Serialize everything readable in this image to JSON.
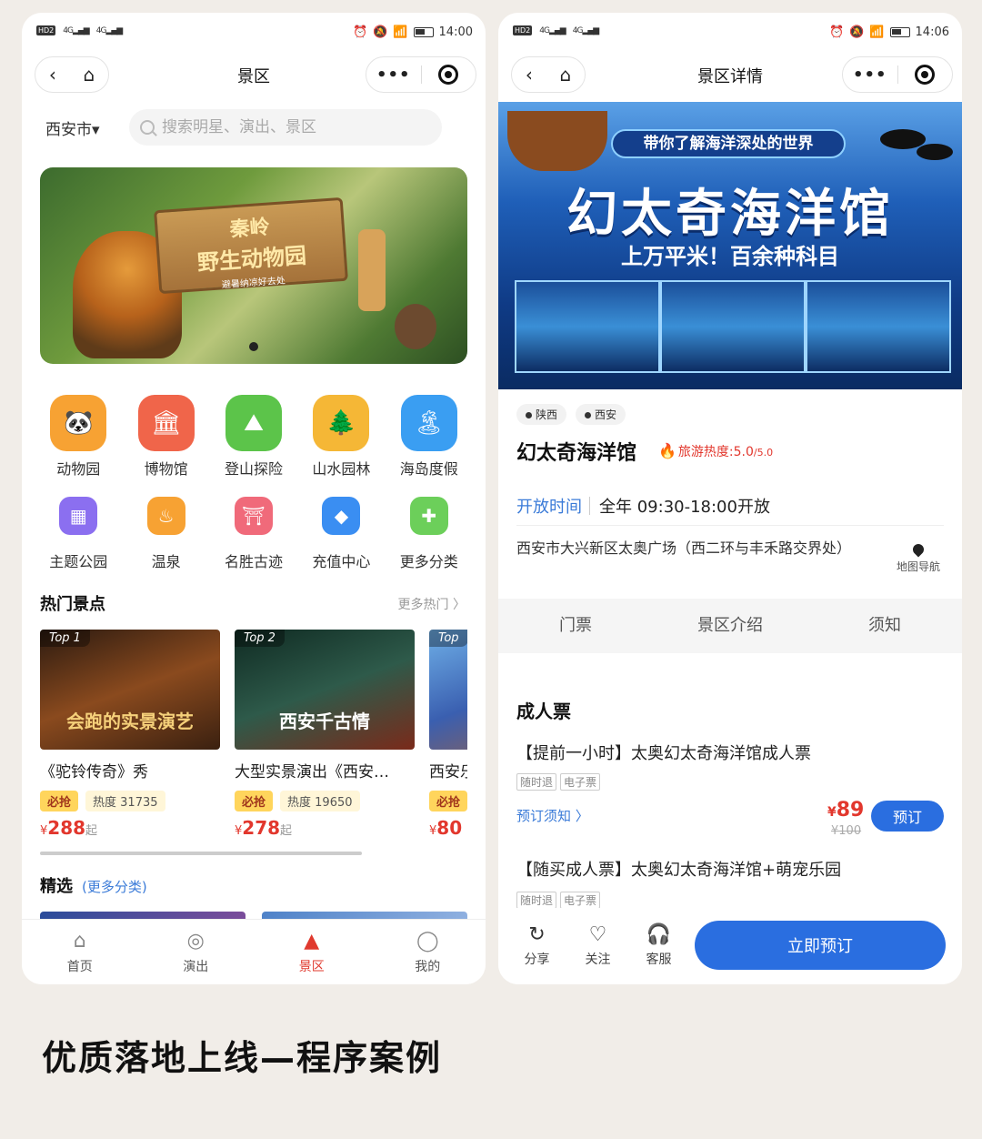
{
  "left": {
    "status": {
      "time": "14:00",
      "net1": "4G",
      "net2": "4G",
      "hd": "HD2"
    },
    "nav_title": "景区",
    "city": "西安市▾",
    "search_placeholder": "搜索明星、演出、景区",
    "banner": {
      "line1": "秦岭",
      "line2": "野生动物园",
      "line3": "避暑纳凉好去处"
    },
    "categories": [
      {
        "label": "动物园",
        "icon": "panda-icon",
        "color": "#f7a233"
      },
      {
        "label": "博物馆",
        "icon": "museum-icon",
        "color": "#f0654a"
      },
      {
        "label": "登山探险",
        "icon": "climb-icon",
        "color": "#5cc44a"
      },
      {
        "label": "山水园林",
        "icon": "forest-icon",
        "color": "#f5b736"
      },
      {
        "label": "海岛度假",
        "icon": "island-icon",
        "color": "#3a9ef2"
      },
      {
        "label": "主题公园",
        "icon": "building-icon",
        "color": "#8b6ff0"
      },
      {
        "label": "温泉",
        "icon": "hotspring-icon",
        "color": "#f7a233"
      },
      {
        "label": "名胜古迹",
        "icon": "monument-icon",
        "color": "#f06a7a"
      },
      {
        "label": "充值中心",
        "icon": "recharge-icon",
        "color": "#3a8ef2"
      },
      {
        "label": "更多分类",
        "icon": "more-category-icon",
        "color": "#6ccf5a"
      }
    ],
    "hot_title": "热门景点",
    "hot_more": "更多热门 〉",
    "hot_items": [
      {
        "top": "Top 1",
        "caption": "会跑的实景演艺",
        "name": "《驼铃传奇》秀",
        "grab": "必抢",
        "heat": "热度 31735",
        "cur": "¥",
        "price": "288",
        "qi": "起",
        "bg": "#6b3a1c"
      },
      {
        "top": "Top 2",
        "caption": "西安千古情",
        "name": "大型实景演出《西安…",
        "grab": "必抢",
        "heat": "热度 19650",
        "cur": "¥",
        "price": "278",
        "qi": "起",
        "bg": "#2e5a4a"
      },
      {
        "top": "Top",
        "caption": "",
        "name": "西安乐",
        "grab": "必抢",
        "heat": "",
        "cur": "¥",
        "price": "80",
        "qi": "",
        "bg": "#3a5fb0"
      }
    ],
    "pick_title": "精选",
    "pick_more": "(更多分类)",
    "tabs": [
      {
        "label": "首页",
        "icon": "home-icon"
      },
      {
        "label": "演出",
        "icon": "show-icon"
      },
      {
        "label": "景区",
        "icon": "scenic-icon"
      },
      {
        "label": "我的",
        "icon": "user-icon"
      }
    ]
  },
  "right": {
    "status": {
      "time": "14:06",
      "net1": "4G",
      "net2": "4G",
      "hd": "HD2"
    },
    "nav_title": "景区详情",
    "hero": {
      "ribbon": "带你了解海洋深处的世界",
      "title": "幻太奇海洋馆",
      "sub": "上万平米！百余种科目"
    },
    "tags": [
      "陕西",
      "西安"
    ],
    "name": "幻太奇海洋馆",
    "heat_label": "旅游热度:5.0",
    "heat_max": "/5.0",
    "open_label": "开放时间",
    "open_value": "全年 09:30-18:00开放",
    "address": "西安市大兴新区太奥广场（西二环与丰禾路交界处）",
    "nav_label": "地图导航",
    "segments": [
      "门票",
      "景区介绍",
      "须知"
    ],
    "ticket_section": "成人票",
    "ticket1": "【提前一小时】太奥幻太奇海洋馆成人票",
    "ticket_tags": [
      "随时退",
      "电子票"
    ],
    "notice": "预订须知 〉",
    "price_cur": "¥",
    "price_now": "89",
    "price_old": "¥100",
    "book_label": "预订",
    "ticket2": "【随买成人票】太奥幻太奇海洋馆+萌宠乐园",
    "actions": [
      {
        "label": "分享",
        "icon": "share-icon"
      },
      {
        "label": "关注",
        "icon": "heart-icon"
      },
      {
        "label": "客服",
        "icon": "headset-icon"
      }
    ],
    "book_now": "立即预订"
  },
  "caption": "优质落地上线—程序案例"
}
